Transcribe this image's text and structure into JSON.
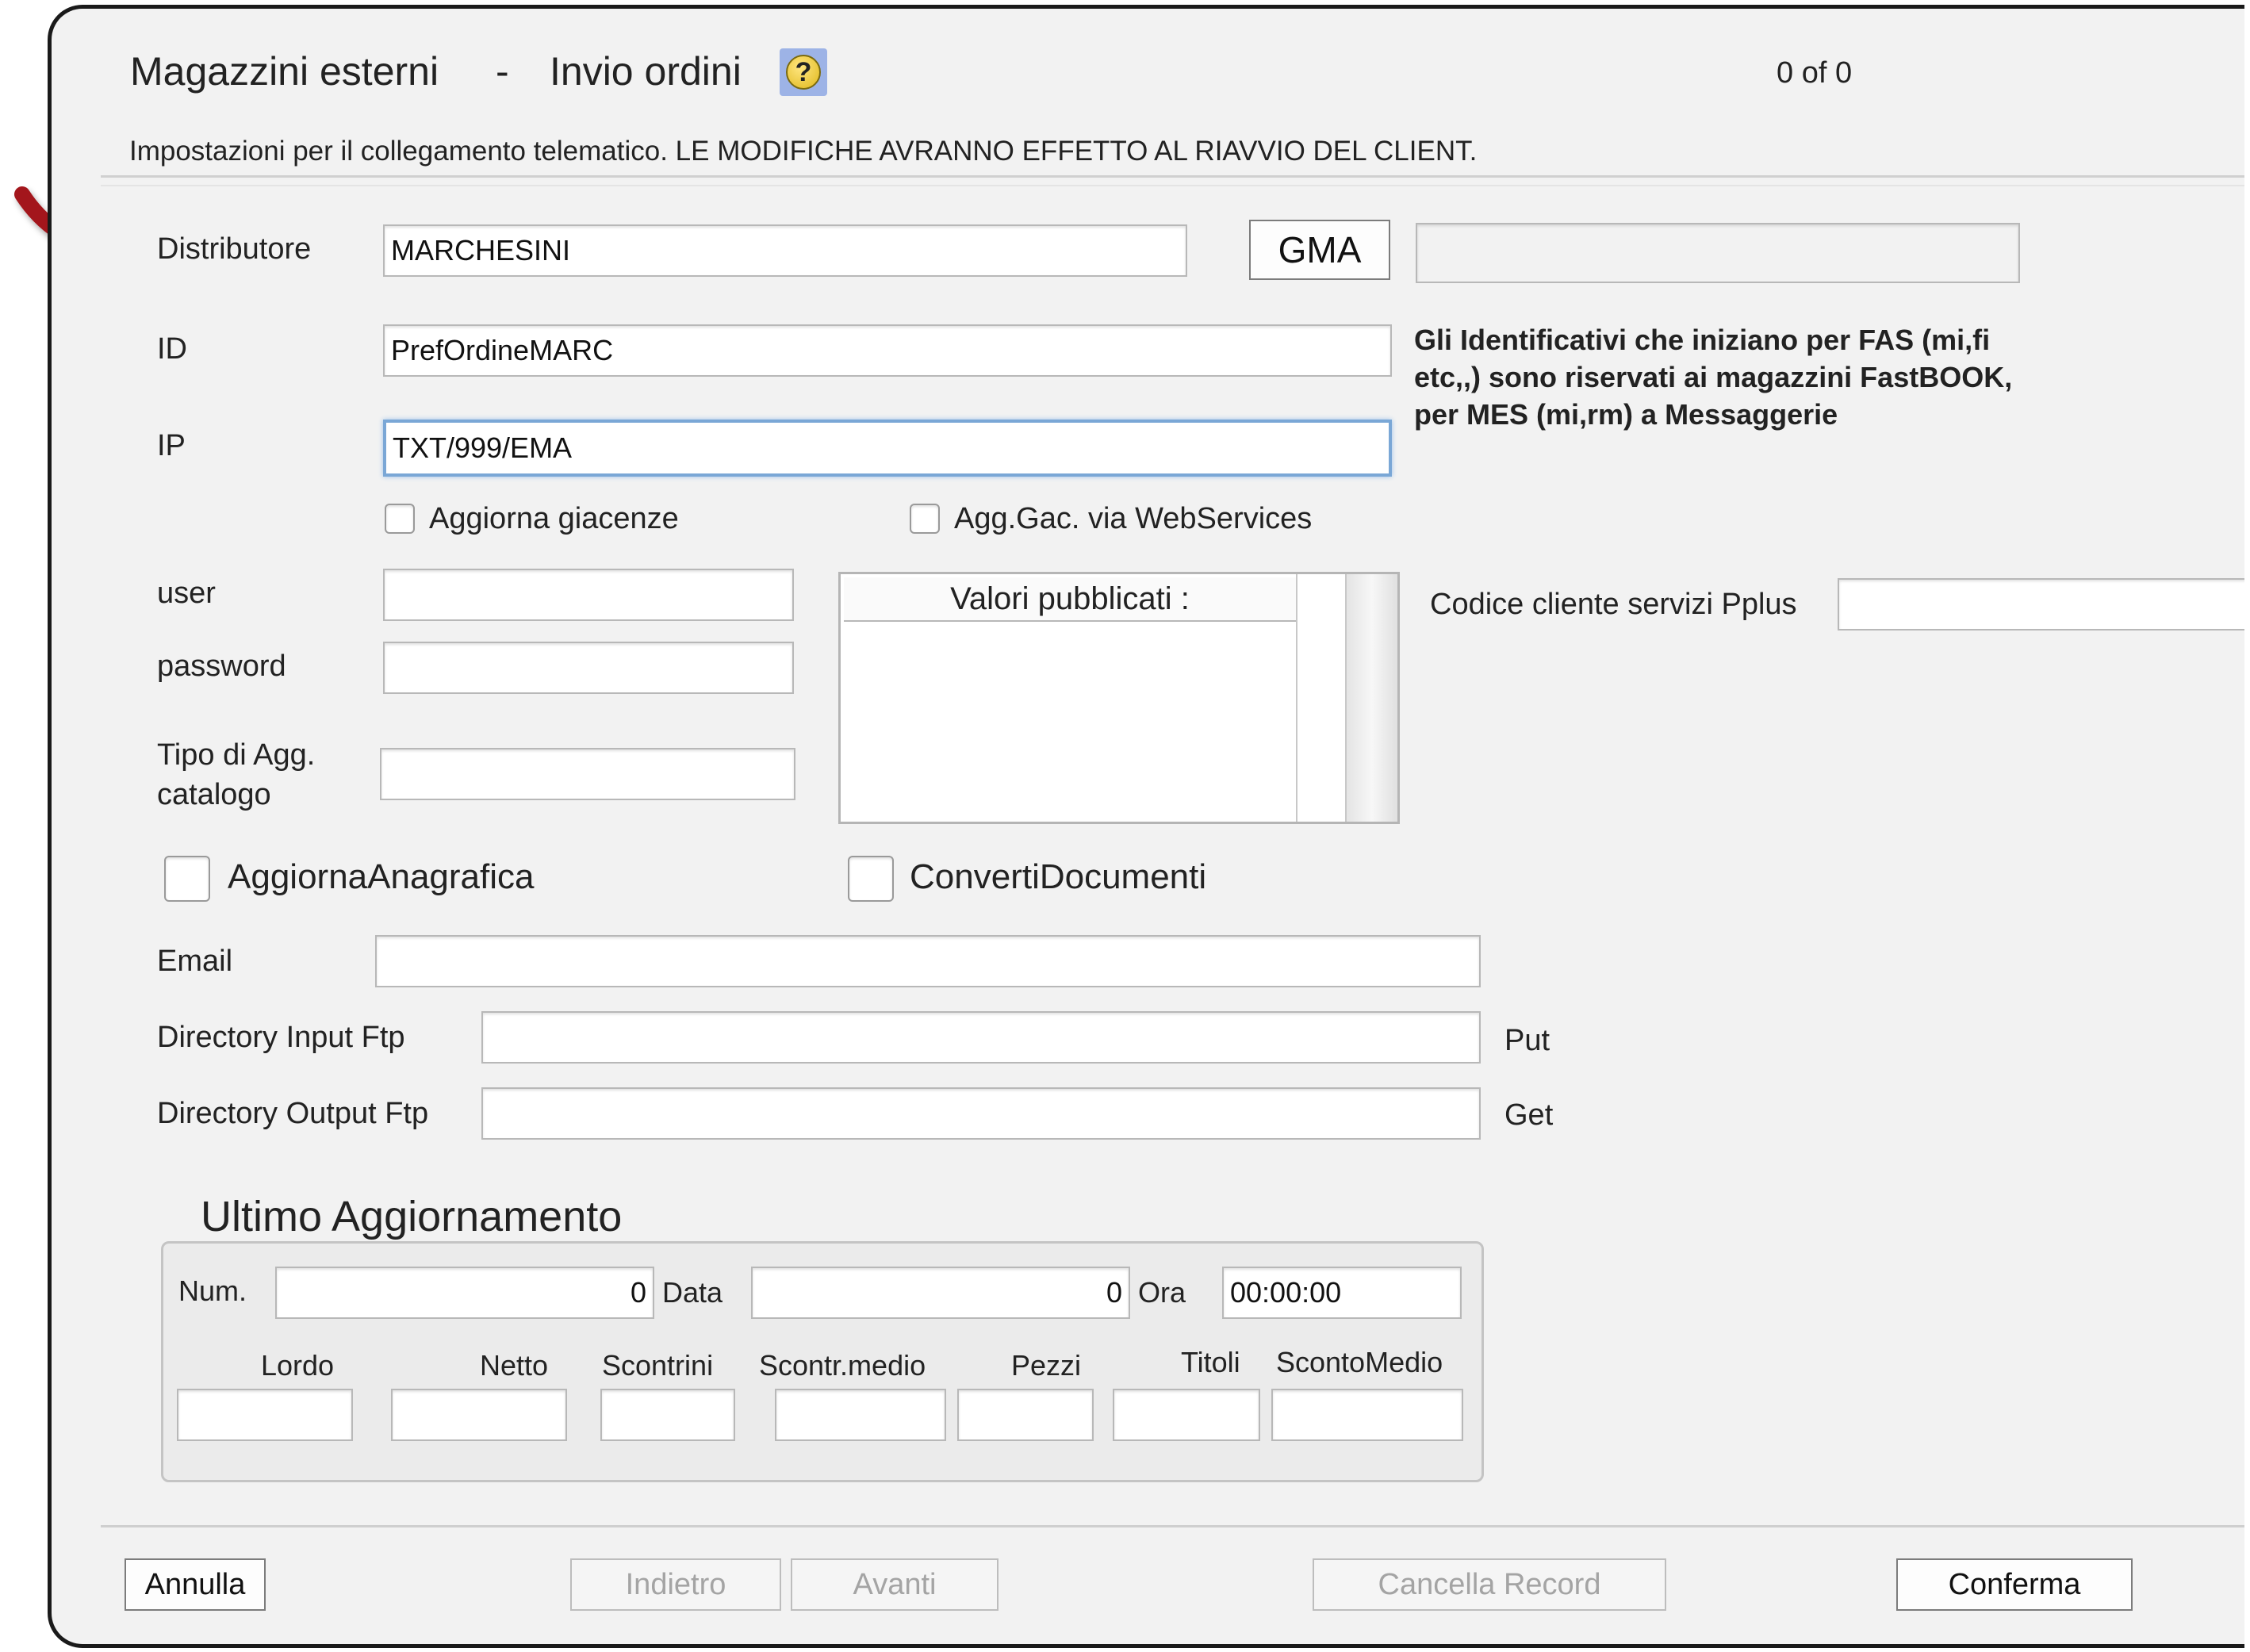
{
  "header": {
    "title_left": "Magazzini esterni",
    "title_dash": "-",
    "title_right": "Invio ordini",
    "help_glyph": "?",
    "record_counter": "0 of 0",
    "description": "Impostazioni per il collegamento telematico. LE MODIFICHE AVRANNO EFFETTO AL RIAVVIO DEL CLIENT."
  },
  "form": {
    "distributore": {
      "label": "Distributore",
      "value": "MARCHESINI"
    },
    "gma_button": "GMA",
    "gma_field": "",
    "id": {
      "label": "ID",
      "value": "PrefOrdineMARC"
    },
    "ip": {
      "label": "IP",
      "value": "TXT/999/EMA"
    },
    "note": "Gli Identificativi che iniziano per FAS (mi,fi etc,,) sono riservati ai magazzini FastBOOK, per MES (mi,rm) a Messaggerie",
    "aggiorna_giacenze": "Aggiorna giacenze",
    "agg_gac_ws": "Agg.Gac. via WebServices",
    "user": {
      "label": "user",
      "value": ""
    },
    "password": {
      "label": "password",
      "value": ""
    },
    "tipo_agg_line1": "Tipo di Agg.",
    "tipo_agg_line2": "catalogo",
    "tipo_agg_value": "",
    "valori_pubblicati": "Valori pubblicati :",
    "codice_cliente": {
      "label": "Codice cliente servizi Pplus",
      "value": ""
    },
    "aggiorna_anagrafica": "AggiornaAnagrafica",
    "converti_documenti": "ConvertiDocumenti",
    "email": {
      "label": "Email",
      "value": ""
    },
    "dir_input": {
      "label": "Directory Input Ftp",
      "value": "",
      "suffix": "Put"
    },
    "dir_output": {
      "label": "Directory Output Ftp",
      "value": "",
      "suffix": "Get"
    }
  },
  "ultimo": {
    "title": "Ultimo Aggiornamento",
    "num_label": "Num.",
    "num_value": "0",
    "data_label": "Data",
    "data_value": "0",
    "ora_label": "Ora",
    "ora_value": "00:00:00",
    "lordo": "Lordo",
    "netto": "Netto",
    "scontrini": "Scontrini",
    "scontr_medio": "Scontr.medio",
    "pezzi": "Pezzi",
    "titoli": "Titoli",
    "sconto_medio": "ScontoMedio"
  },
  "footer": {
    "annulla": "Annulla",
    "indietro": "Indietro",
    "avanti": "Avanti",
    "cancella": "Cancella Record",
    "conferma": "Conferma"
  },
  "annotation_color": "#a3161a"
}
